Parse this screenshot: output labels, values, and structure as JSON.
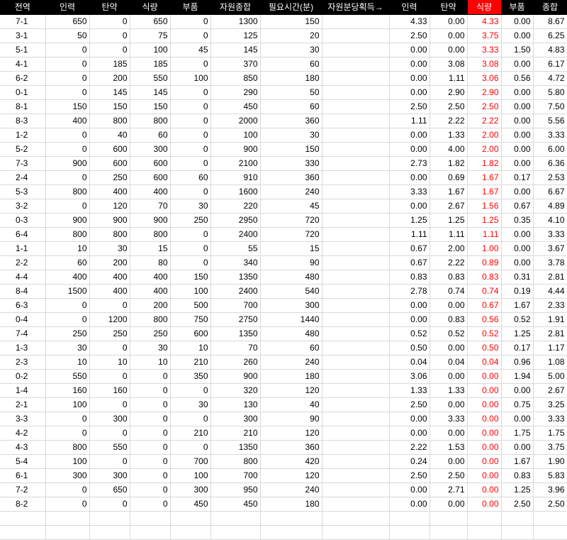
{
  "headers": [
    "전역",
    "인력",
    "탄약",
    "식량",
    "부품",
    "자원종합",
    "필요시간(분)",
    "자원분당획득→",
    "인력",
    "탄약",
    "식량",
    "부품",
    "종합"
  ],
  "accent_color": "#ff0000",
  "rows": [
    [
      "7-1",
      "650",
      "0",
      "650",
      "0",
      "1300",
      "150",
      "",
      "4.33",
      "0.00",
      "4.33",
      "0.00",
      "8.67"
    ],
    [
      "3-1",
      "50",
      "0",
      "75",
      "0",
      "125",
      "20",
      "",
      "2.50",
      "0.00",
      "3.75",
      "0.00",
      "6.25"
    ],
    [
      "5-1",
      "0",
      "0",
      "100",
      "45",
      "145",
      "30",
      "",
      "0.00",
      "0.00",
      "3.33",
      "1.50",
      "4.83"
    ],
    [
      "4-1",
      "0",
      "185",
      "185",
      "0",
      "370",
      "60",
      "",
      "0.00",
      "3.08",
      "3.08",
      "0.00",
      "6.17"
    ],
    [
      "6-2",
      "0",
      "200",
      "550",
      "100",
      "850",
      "180",
      "",
      "0.00",
      "1.11",
      "3.06",
      "0.56",
      "4.72"
    ],
    [
      "0-1",
      "0",
      "145",
      "145",
      "0",
      "290",
      "50",
      "",
      "0.00",
      "2.90",
      "2.90",
      "0.00",
      "5.80"
    ],
    [
      "8-1",
      "150",
      "150",
      "150",
      "0",
      "450",
      "60",
      "",
      "2.50",
      "2.50",
      "2.50",
      "0.00",
      "7.50"
    ],
    [
      "8-3",
      "400",
      "800",
      "800",
      "0",
      "2000",
      "360",
      "",
      "1.11",
      "2.22",
      "2.22",
      "0.00",
      "5.56"
    ],
    [
      "1-2",
      "0",
      "40",
      "60",
      "0",
      "100",
      "30",
      "",
      "0.00",
      "1.33",
      "2.00",
      "0.00",
      "3.33"
    ],
    [
      "5-2",
      "0",
      "600",
      "300",
      "0",
      "900",
      "150",
      "",
      "0.00",
      "4.00",
      "2.00",
      "0.00",
      "6.00"
    ],
    [
      "7-3",
      "900",
      "600",
      "600",
      "0",
      "2100",
      "330",
      "",
      "2.73",
      "1.82",
      "1.82",
      "0.00",
      "6.36"
    ],
    [
      "2-4",
      "0",
      "250",
      "600",
      "60",
      "910",
      "360",
      "",
      "0.00",
      "0.69",
      "1.67",
      "0.17",
      "2.53"
    ],
    [
      "5-3",
      "800",
      "400",
      "400",
      "0",
      "1600",
      "240",
      "",
      "3.33",
      "1.67",
      "1.67",
      "0.00",
      "6.67"
    ],
    [
      "3-2",
      "0",
      "120",
      "70",
      "30",
      "220",
      "45",
      "",
      "0.00",
      "2.67",
      "1.56",
      "0.67",
      "4.89"
    ],
    [
      "0-3",
      "900",
      "900",
      "900",
      "250",
      "2950",
      "720",
      "",
      "1.25",
      "1.25",
      "1.25",
      "0.35",
      "4.10"
    ],
    [
      "6-4",
      "800",
      "800",
      "800",
      "0",
      "2400",
      "720",
      "",
      "1.11",
      "1.11",
      "1.11",
      "0.00",
      "3.33"
    ],
    [
      "1-1",
      "10",
      "30",
      "15",
      "0",
      "55",
      "15",
      "",
      "0.67",
      "2.00",
      "1.00",
      "0.00",
      "3.67"
    ],
    [
      "2-2",
      "60",
      "200",
      "80",
      "0",
      "340",
      "90",
      "",
      "0.67",
      "2.22",
      "0.89",
      "0.00",
      "3.78"
    ],
    [
      "4-4",
      "400",
      "400",
      "400",
      "150",
      "1350",
      "480",
      "",
      "0.83",
      "0.83",
      "0.83",
      "0.31",
      "2.81"
    ],
    [
      "8-4",
      "1500",
      "400",
      "400",
      "100",
      "2400",
      "540",
      "",
      "2.78",
      "0.74",
      "0.74",
      "0.19",
      "4.44"
    ],
    [
      "6-3",
      "0",
      "0",
      "200",
      "500",
      "700",
      "300",
      "",
      "0.00",
      "0.00",
      "0.67",
      "1.67",
      "2.33"
    ],
    [
      "0-4",
      "0",
      "1200",
      "800",
      "750",
      "2750",
      "1440",
      "",
      "0.00",
      "0.83",
      "0.56",
      "0.52",
      "1.91"
    ],
    [
      "7-4",
      "250",
      "250",
      "250",
      "600",
      "1350",
      "480",
      "",
      "0.52",
      "0.52",
      "0.52",
      "1.25",
      "2.81"
    ],
    [
      "1-3",
      "30",
      "0",
      "30",
      "10",
      "70",
      "60",
      "",
      "0.50",
      "0.00",
      "0.50",
      "0.17",
      "1.17"
    ],
    [
      "2-3",
      "10",
      "10",
      "10",
      "210",
      "260",
      "240",
      "",
      "0.04",
      "0.04",
      "0.04",
      "0.96",
      "1.08"
    ],
    [
      "0-2",
      "550",
      "0",
      "0",
      "350",
      "900",
      "180",
      "",
      "3.06",
      "0.00",
      "0.00",
      "1.94",
      "5.00"
    ],
    [
      "1-4",
      "160",
      "160",
      "0",
      "0",
      "320",
      "120",
      "",
      "1.33",
      "1.33",
      "0.00",
      "0.00",
      "2.67"
    ],
    [
      "2-1",
      "100",
      "0",
      "0",
      "30",
      "130",
      "40",
      "",
      "2.50",
      "0.00",
      "0.00",
      "0.75",
      "3.25"
    ],
    [
      "3-3",
      "0",
      "300",
      "0",
      "0",
      "300",
      "90",
      "",
      "0.00",
      "3.33",
      "0.00",
      "0.00",
      "3.33"
    ],
    [
      "4-2",
      "0",
      "0",
      "0",
      "210",
      "210",
      "120",
      "",
      "0.00",
      "0.00",
      "0.00",
      "1.75",
      "1.75"
    ],
    [
      "4-3",
      "800",
      "550",
      "0",
      "0",
      "1350",
      "360",
      "",
      "2.22",
      "1.53",
      "0.00",
      "0.00",
      "3.75"
    ],
    [
      "5-4",
      "100",
      "0",
      "0",
      "700",
      "800",
      "420",
      "",
      "0.24",
      "0.00",
      "0.00",
      "1.67",
      "1.90"
    ],
    [
      "6-1",
      "300",
      "300",
      "0",
      "100",
      "700",
      "120",
      "",
      "2.50",
      "2.50",
      "0.00",
      "0.83",
      "5.83"
    ],
    [
      "7-2",
      "0",
      "650",
      "0",
      "300",
      "950",
      "240",
      "",
      "0.00",
      "2.71",
      "0.00",
      "1.25",
      "3.96"
    ],
    [
      "8-2",
      "0",
      "0",
      "0",
      "450",
      "450",
      "180",
      "",
      "0.00",
      "0.00",
      "0.00",
      "2.50",
      "2.50"
    ]
  ]
}
